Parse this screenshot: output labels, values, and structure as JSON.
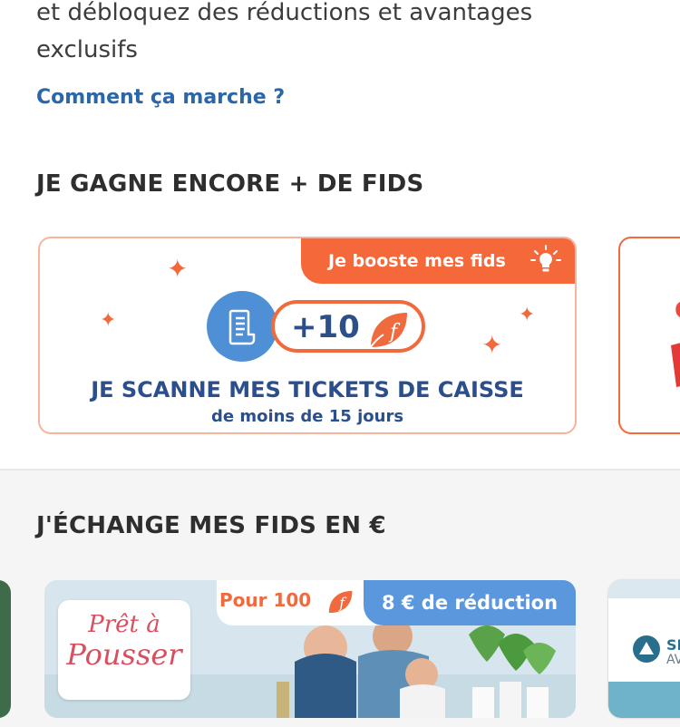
{
  "intro": {
    "text": "et débloquez des réductions et avantages exclusifs",
    "link": "Comment ça marche ?"
  },
  "section1": {
    "title": "JE GAGNE ENCORE + DE FIDS",
    "boost_card": {
      "tag": "Je booste mes fids",
      "points": "+10",
      "title": "JE SCANNE MES TICKETS DE CAISSE",
      "subtitle": "de moins de 15 jours"
    }
  },
  "section2": {
    "title": "J'ÉCHANGE MES FIDS EN €",
    "offer_card": {
      "cost_label": "Pour 100",
      "reduction": "8 € de réduction",
      "brand_line1": "Prêt à",
      "brand_line2": "Pousser"
    },
    "peek_card_right": {
      "text_line1": "SE",
      "text_line2": "AV"
    }
  },
  "colors": {
    "accent_orange": "#f4683a",
    "accent_blue": "#5b97dc",
    "title_navy": "#2b4e8c",
    "link_blue": "#2a66a8"
  },
  "icons": [
    "receipt-icon",
    "fids-leaf-icon",
    "lightbulb-icon",
    "sparkle-icon"
  ]
}
